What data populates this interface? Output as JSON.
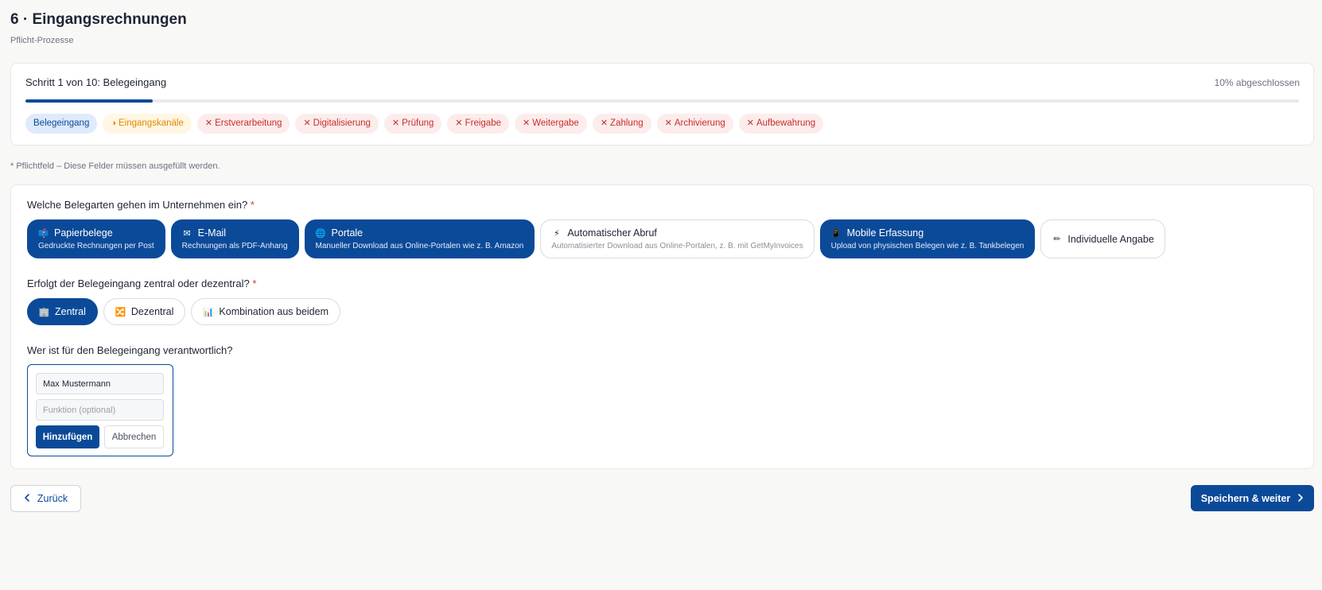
{
  "header": {
    "title": "6 · Eingangsrechnungen",
    "subtitle": "Pflicht-Prozesse"
  },
  "progress": {
    "step_label": "Schritt 1 von 10: Belegeingang",
    "percent_label": "10% abgeschlossen",
    "fraction": 0.1,
    "steps": [
      {
        "label": "Belegeingang",
        "state": "current",
        "icon": ""
      },
      {
        "label": "Eingangskanäle",
        "state": "partial",
        "icon": "◑"
      },
      {
        "label": "Erstverarbeitung",
        "state": "todo",
        "icon": "✕"
      },
      {
        "label": "Digitalisierung",
        "state": "todo",
        "icon": "✕"
      },
      {
        "label": "Prüfung",
        "state": "todo",
        "icon": "✕"
      },
      {
        "label": "Freigabe",
        "state": "todo",
        "icon": "✕"
      },
      {
        "label": "Weitergabe",
        "state": "todo",
        "icon": "✕"
      },
      {
        "label": "Zahlung",
        "state": "todo",
        "icon": "✕"
      },
      {
        "label": "Archivierung",
        "state": "todo",
        "icon": "✕"
      },
      {
        "label": "Aufbewahrung",
        "state": "todo",
        "icon": "✕"
      }
    ]
  },
  "required_note": "* Pflichtfeld – Diese Felder müssen ausgefüllt werden.",
  "q1": {
    "label": "Welche Belegarten gehen im Unternehmen ein?",
    "required_mark": "*",
    "options": [
      {
        "title": "Papierbelege",
        "desc": "Gedruckte Rechnungen per Post",
        "icon": "mailbox-icon",
        "glyph": "📫",
        "selected": true
      },
      {
        "title": "E-Mail",
        "desc": "Rechnungen als PDF-Anhang",
        "icon": "envelope-icon",
        "glyph": "✉",
        "selected": true
      },
      {
        "title": "Portale",
        "desc": "Manueller Download aus Online-Portalen wie z. B. Amazon",
        "icon": "globe-icon",
        "glyph": "🌐",
        "selected": true
      },
      {
        "title": "Automatischer Abruf",
        "desc": "Automatisierter Download aus Online-Portalen, z. B. mit GetMyInvoices",
        "icon": "lightning-icon",
        "glyph": "⚡",
        "selected": false
      },
      {
        "title": "Mobile Erfassung",
        "desc": "Upload von physischen Belegen wie z. B. Tankbelegen",
        "icon": "phone-icon",
        "glyph": "📱",
        "selected": true
      },
      {
        "title": "Individuelle Angabe",
        "desc": "",
        "icon": "pencil-icon",
        "glyph": "✏",
        "selected": false
      }
    ]
  },
  "q2": {
    "label": "Erfolgt der Belegeingang zentral oder dezentral?",
    "required_mark": "*",
    "options": [
      {
        "title": "Zentral",
        "icon": "building-icon",
        "glyph": "🏢",
        "selected": true
      },
      {
        "title": "Dezentral",
        "icon": "shuffle-icon",
        "glyph": "🔀",
        "selected": false
      },
      {
        "title": "Kombination aus beidem",
        "icon": "chart-icon",
        "glyph": "📊",
        "selected": false
      }
    ]
  },
  "q3": {
    "label": "Wer ist für den Belegeingang verantwortlich?",
    "name_value": "Max Mustermann",
    "function_placeholder": "Funktion (optional)",
    "add_label": "Hinzufügen",
    "cancel_label": "Abbrechen"
  },
  "nav": {
    "back_label": "Zurück",
    "next_label": "Speichern & weiter"
  },
  "colors": {
    "primary": "#0b4a99",
    "required": "#d63a2f",
    "partial": "#e08a00",
    "todo": "#c4302b"
  }
}
